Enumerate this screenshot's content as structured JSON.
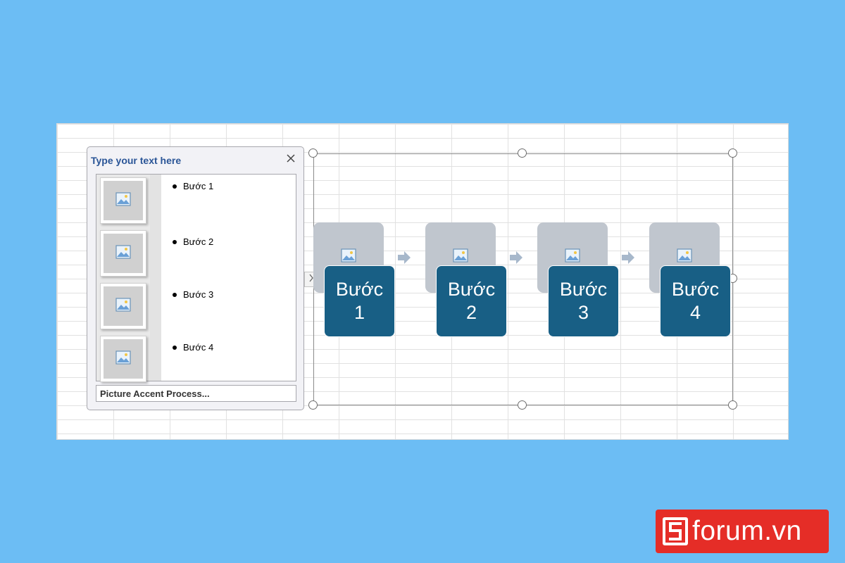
{
  "text_pane": {
    "title": "Type your text here",
    "items": [
      {
        "label": "Bước 1"
      },
      {
        "label": "Bước 2"
      },
      {
        "label": "Bước 3"
      },
      {
        "label": "Bước 4"
      }
    ],
    "footer": "Picture Accent Process..."
  },
  "smartart": {
    "steps": [
      {
        "line1": "Bước",
        "line2": "1"
      },
      {
        "line1": "Bước",
        "line2": "2"
      },
      {
        "line1": "Bước",
        "line2": "3"
      },
      {
        "line1": "Bước",
        "line2": "4"
      }
    ]
  },
  "logo": {
    "text": "forum.vn"
  },
  "colors": {
    "background": "#6cbdf4",
    "step_fill": "#185f85",
    "picture_placeholder": "#c0c6ce",
    "pane_title": "#2a5597",
    "logo_bg": "#e52d27"
  }
}
